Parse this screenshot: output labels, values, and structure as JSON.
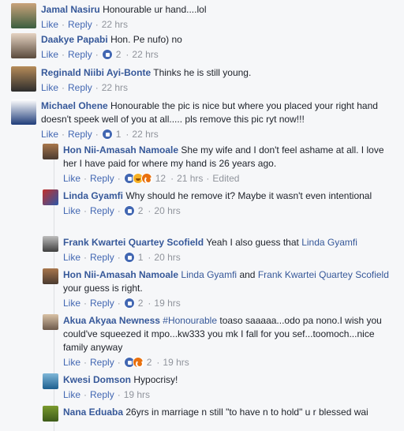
{
  "thread": {
    "actions": {
      "like": "Like",
      "reply": "Reply",
      "sep": "·"
    },
    "comments": [
      {
        "author": "Jamal Nasiru",
        "text": "Honourable ur hand....lol",
        "reactions": "",
        "time": "22 hrs",
        "colors": [
          "#3b5e3f",
          "#c9a27a"
        ]
      },
      {
        "author": "Daakye Papabi",
        "text": "Hon. Pe nufo) no",
        "reactions": "2",
        "time": "22 hrs",
        "colors": [
          "#5a4a3c",
          "#e5d3c2"
        ]
      },
      {
        "author": "Reginald Niibi Ayi-Bonte",
        "text": "Thinks he is still young.",
        "reactions": "",
        "time": "22 hrs",
        "colors": [
          "#2d2d2d",
          "#b68b59"
        ]
      },
      {
        "author": "Michael Ohene",
        "text": "Honourable the pic is nice but where you placed your right hand doesn't speek well of you at all..... pls remove this pic ryt now!!!",
        "reactions": "1",
        "time": "22 hrs",
        "colors": [
          "#1f3d7a",
          "#ffffff"
        ]
      }
    ],
    "replies": [
      {
        "author": "Hon Nii-Amasah Namoale",
        "text": "She my wife and I don't feel ashame at all. I love her I have paid for where my hand is 26 years ago.",
        "reactions": "12",
        "time": "21 hrs",
        "edited": "Edited",
        "colors": [
          "#4a3a30",
          "#a8764c"
        ]
      },
      {
        "author": "Linda Gyamfi",
        "text": "Why should he remove it? Maybe it wasn't even intentional",
        "reactions": "2",
        "time": "20 hrs",
        "colors": [
          "#c2302b",
          "#2b57a8"
        ]
      },
      {
        "author": "Frank Kwartei Quartey Scofield",
        "text": "Yeah I also guess that",
        "tag": "Linda Gyamfi",
        "reactions": "1",
        "time": "20 hrs",
        "colors": [
          "#bdbdbd",
          "#3f3f3f"
        ]
      },
      {
        "author": "Hon Nii-Amasah Namoale",
        "tag1": "Linda Gyamfi",
        "mid": "and",
        "tag2": "Frank Kwartei Quartey Scofield",
        "text": "your guess is right.",
        "reactions": "2",
        "time": "19 hrs",
        "colors": [
          "#4a3a30",
          "#a8764c"
        ]
      },
      {
        "author": "Akua Akyaa Newness",
        "hashtag": "#Honourable",
        "text": "toaso saaaaa...odo pa nono.I wish you could've squeezed it mpo...kw333 you mk I fall for you sef...toomoch...nice family anyway",
        "reactions": "2",
        "time": "19 hrs",
        "colors": [
          "#6d5a4c",
          "#d9c2a6"
        ]
      },
      {
        "author": "Kwesi Domson",
        "text": "Hypocrisy!",
        "reactions": "",
        "time": "19 hrs",
        "colors": [
          "#1d5f8f",
          "#7fb7d8"
        ]
      },
      {
        "author": "Nana Eduaba",
        "text": "26yrs in marriage n still \"to have n to hold\" u r blessed wai",
        "reactions": "",
        "time": "",
        "colors": [
          "#7a9a2e",
          "#3d5b1a"
        ]
      }
    ]
  }
}
